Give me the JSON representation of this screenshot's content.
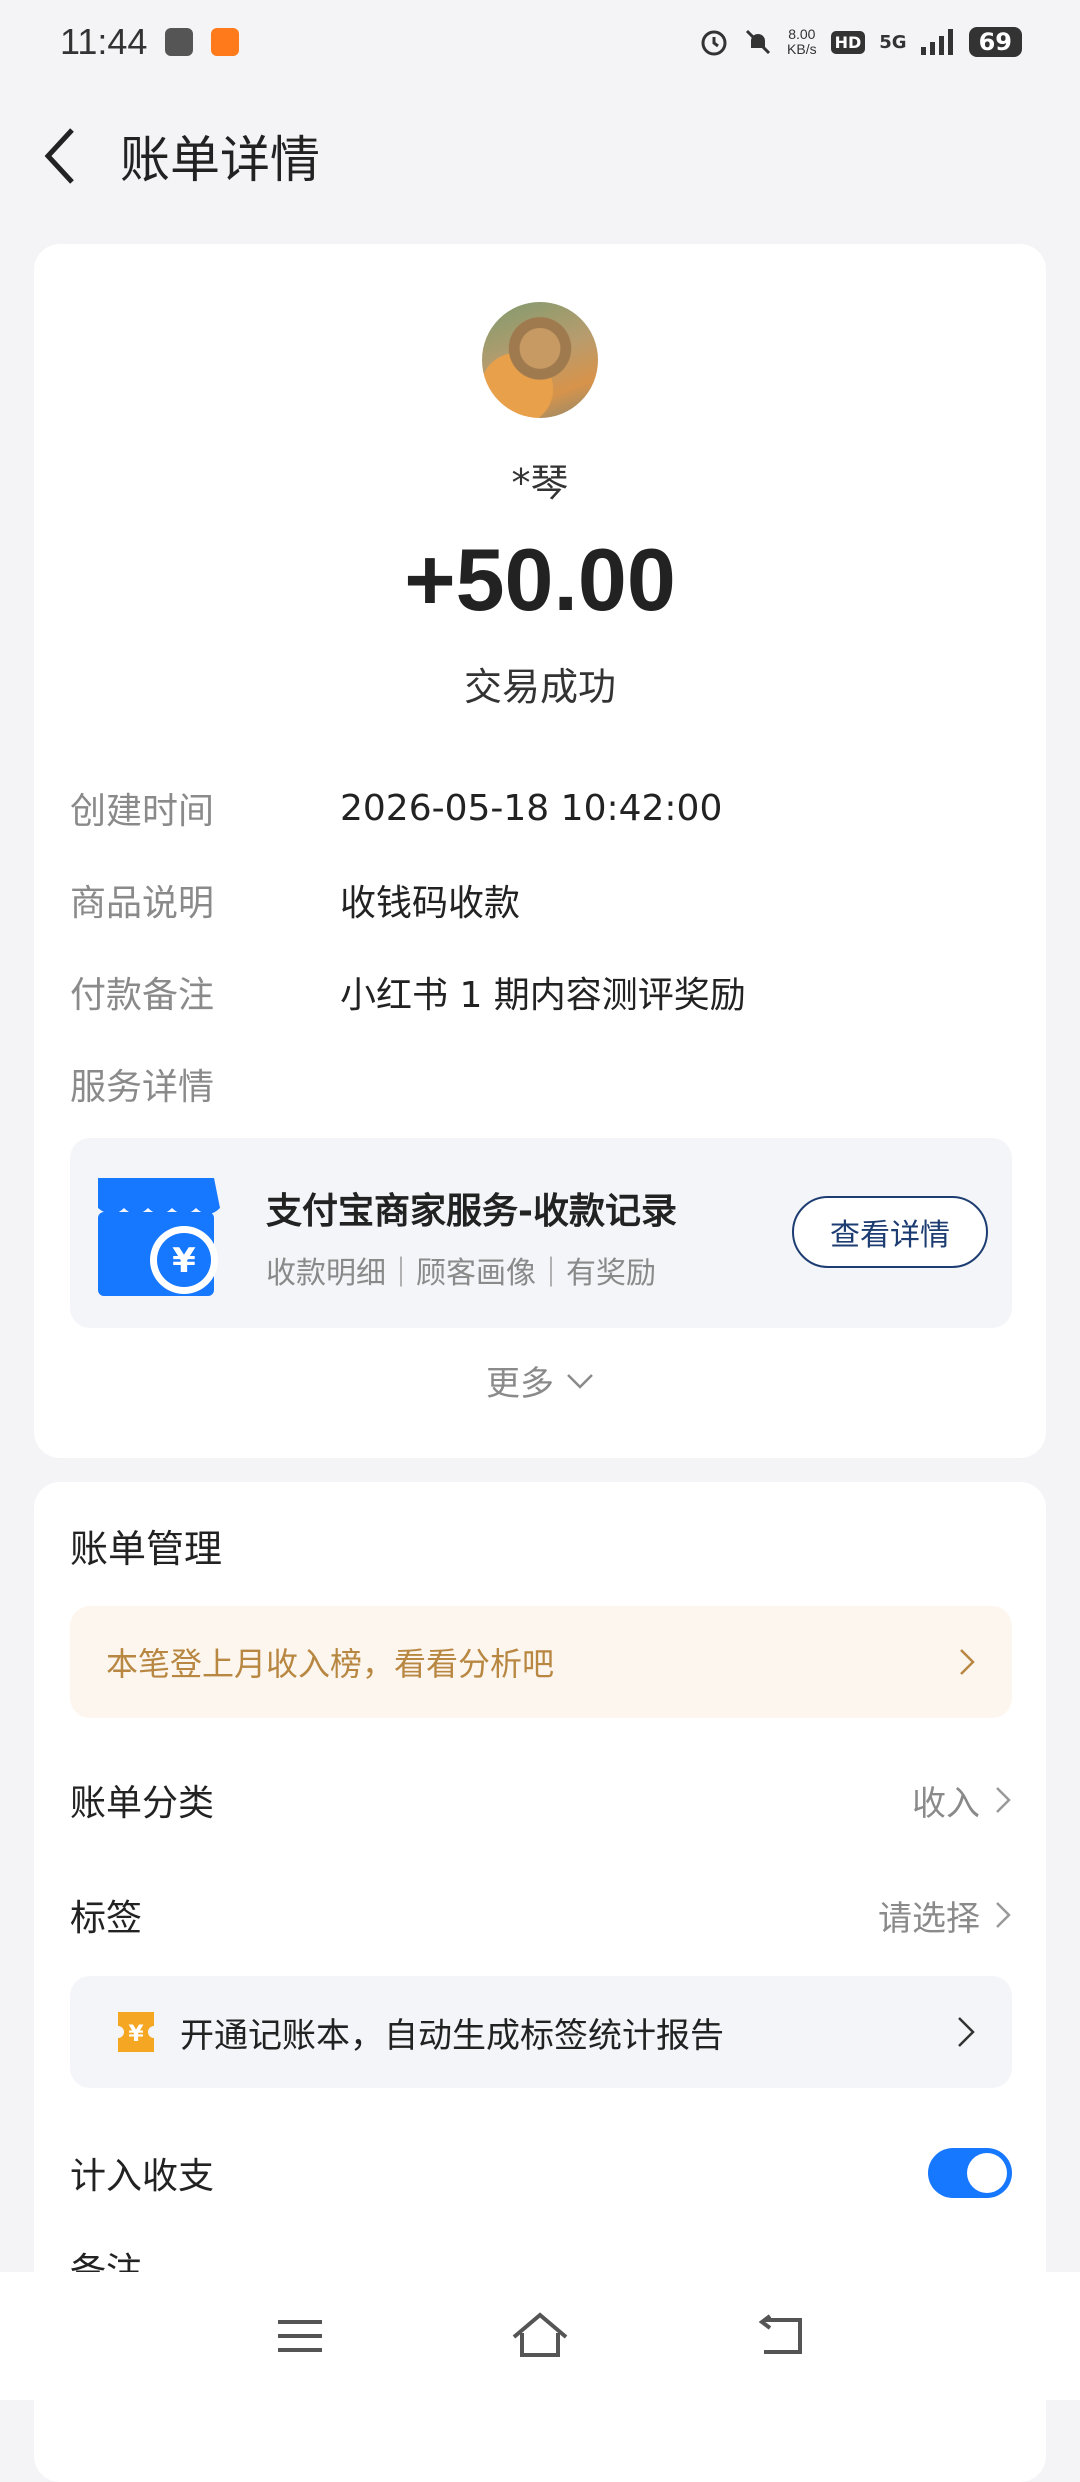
{
  "status_bar": {
    "time": "11:44",
    "net_speed_value": "8.00",
    "net_speed_unit": "KB/s",
    "hd_label": "HD",
    "signal_label": "5G",
    "battery": "69",
    "icons": [
      "alarm-icon",
      "bell-muted-icon",
      "signal-icon"
    ]
  },
  "header": {
    "title": "账单详情"
  },
  "transaction": {
    "counterparty": "*琴",
    "amount": "+50.00",
    "status": "交易成功"
  },
  "details": [
    {
      "label": "创建时间",
      "value": "2026-05-18 10:42:00"
    },
    {
      "label": "商品说明",
      "value": "收钱码收款"
    },
    {
      "label": "付款备注",
      "value": "小红书 1 期内容测评奖励"
    },
    {
      "label": "服务详情",
      "value": ""
    }
  ],
  "service": {
    "title": "支付宝商家服务-收款记录",
    "subtitle": "收款明细｜顾客画像｜有奖励",
    "button": "查看详情",
    "icon_symbol": "¥"
  },
  "more": {
    "label": "更多"
  },
  "management": {
    "title": "账单管理",
    "banner": "本笔登上月收入榜，看看分析吧",
    "rows": [
      {
        "label": "账单分类",
        "value": "收入"
      },
      {
        "label": "标签",
        "value": "请选择"
      }
    ],
    "promo": "开通记账本，自动生成标签统计报告",
    "promo_icon_symbol": "¥",
    "toggle_label": "计入收支",
    "toggle_on": true,
    "remark_label": "备注"
  },
  "colors": {
    "accent": "#1677ff",
    "banner_text": "#b88742",
    "service_icon": "#1677ff"
  }
}
